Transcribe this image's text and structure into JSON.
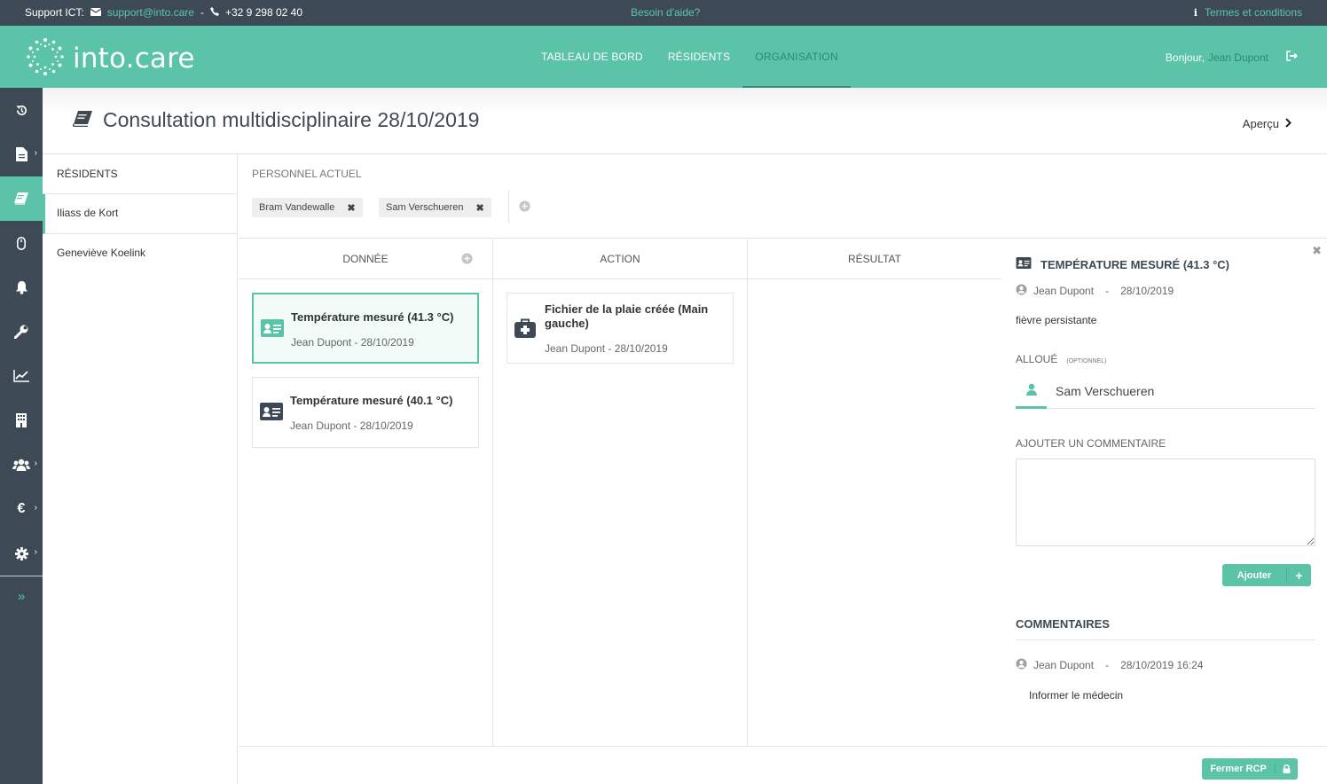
{
  "topbar": {
    "support_label": "Support ICT:",
    "email": "support@into.care",
    "separator": "-",
    "phone": "+32 9 298 02 40",
    "help": "Besoin d'aide?",
    "terms": "Termes et conditions"
  },
  "header": {
    "logo": "into.care",
    "nav": [
      "TABLEAU DE BORD",
      "RÉSIDENTS",
      "ORGANISATION"
    ],
    "active_nav": "ORGANISATION",
    "greeting": "Bonjour,",
    "user": "Jean Dupont"
  },
  "sidebar": {
    "items": [
      "history-icon",
      "document-icon",
      "book-icon",
      "mouse-icon",
      "bell-icon",
      "wrench-icon",
      "chart-icon",
      "building-icon",
      "users-icon",
      "euro-icon",
      "gear-icon"
    ],
    "active_index": 2
  },
  "page": {
    "title": "Consultation multidisciplinaire 28/10/2019",
    "preview": "Aperçu"
  },
  "residents": {
    "header": "RÉSIDENTS",
    "items": [
      "Iliass de Kort",
      "Geneviève Koelink"
    ]
  },
  "staff": {
    "label": "PERSONNEL ACTUEL",
    "members": [
      "Bram Vandewalle",
      "Sam Verschueren"
    ]
  },
  "columns": {
    "data": "DONNÉE",
    "action": "ACTION",
    "result": "RÉSULTAT"
  },
  "cards": {
    "data": [
      {
        "title": "Température mesuré (41.3 °C)",
        "meta": "Jean Dupont - 28/10/2019"
      },
      {
        "title": "Température mesuré (40.1 °C)",
        "meta": "Jean Dupont - 28/10/2019"
      }
    ],
    "action": [
      {
        "title": "Fichier de la plaie créée (Main gauche)",
        "meta": "Jean Dupont - 28/10/2019"
      }
    ]
  },
  "detail": {
    "title": "TEMPÉRATURE MESURÉ (41.3 °C)",
    "author": "Jean Dupont",
    "dash": "-",
    "date": "28/10/2019",
    "description": "fièvre persistante",
    "alloc_label": "ALLOUÉ",
    "alloc_optional": "(OPTIONNEL)",
    "alloc_value": "Sam Verschueren",
    "comment_label": "AJOUTER UN COMMENTAIRE",
    "comment_value": "",
    "add_button": "Ajouter",
    "comments_header": "COMMENTAIRES",
    "comments": [
      {
        "author": "Jean Dupont",
        "date": "28/10/2019 16:24",
        "text": "Informer le médecin"
      }
    ]
  },
  "footer": {
    "close_button": "Fermer RCP"
  },
  "colors": {
    "accent": "#5ac3a8",
    "dark": "#3d4a55"
  }
}
